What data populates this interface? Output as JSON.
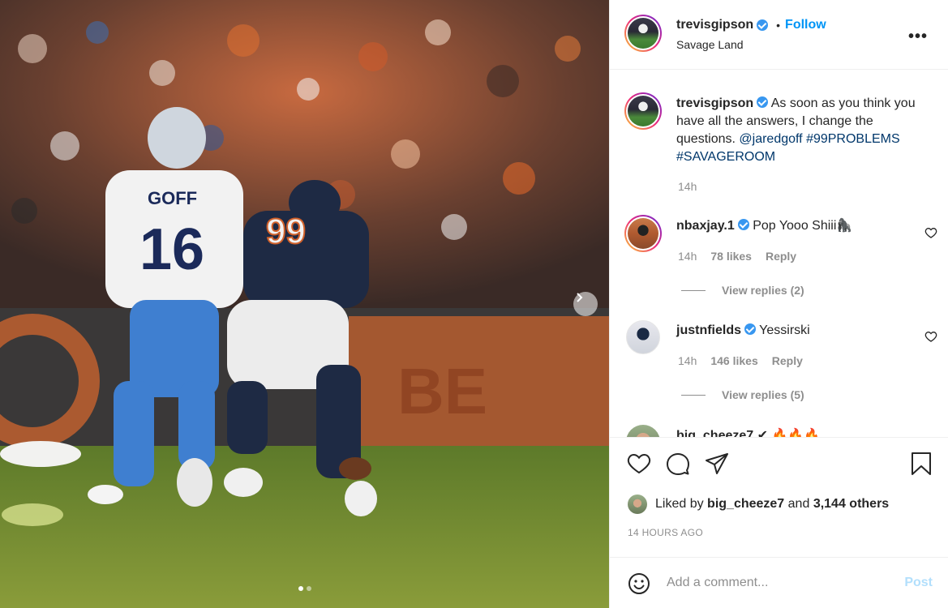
{
  "post": {
    "photo_alt": "",
    "carousel_dots": 2,
    "active_dot": 0
  },
  "header": {
    "username": "trevisgipson",
    "separator": "•",
    "follow_label": "Follow",
    "location": "Savage Land",
    "more_label": "•••"
  },
  "caption": {
    "username": "trevisgipson",
    "text_before": "As soon as you think you have all the answers, I change the questions. ",
    "mention": "@jaredgoff",
    "hashtag1": "#99PROBLEMS",
    "hashtag2": "#SAVAGEROOM",
    "time": "14h"
  },
  "comments": [
    {
      "username": "nbaxjay.1",
      "text": "Pop Yooo Shiii🦍",
      "time": "14h",
      "likes": "78 likes",
      "reply_label": "Reply",
      "view_replies": "View replies (2)"
    },
    {
      "username": "justnfields",
      "text": "Yessirski",
      "time": "14h",
      "likes": "146 likes",
      "reply_label": "Reply",
      "view_replies": "View replies (5)"
    }
  ],
  "partial_comment": {
    "text": "big_cheeze7 ✔ 🔥🔥🔥"
  },
  "actions": {
    "liked_prefix": "Liked by ",
    "liked_user": "big_cheeze7",
    "liked_and": " and ",
    "liked_others": "3,144 others",
    "timestamp": "14 HOURS AGO"
  },
  "add_comment": {
    "placeholder": "Add a comment...",
    "post_label": "Post"
  },
  "colors": {
    "accent": "#0095f6",
    "post_disabled": "#b2dffc",
    "verified": "#3897f0",
    "meta": "#8e8e8e",
    "link": "#00376b"
  }
}
